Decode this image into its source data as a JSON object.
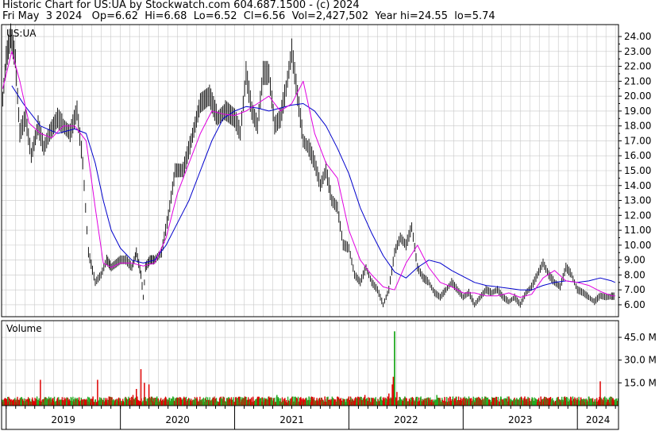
{
  "header": {
    "line1": "Historic Chart for US:UA by Stockwatch.com 604.687.1500 - (c) 2024",
    "line2": "Fri May  3 2024   Op=6.62  Hi=6.68  Lo=6.52  Cl=6.56  Vol=2,427,502  Year hi=24.55  lo=5.74"
  },
  "colors": {
    "price": "#000000",
    "ma_short": "#e000e0",
    "ma_long": "#0000cc",
    "vol_up": "#22aa22",
    "vol_down": "#dd0000",
    "grid": "#c8c8c8"
  },
  "chart_data": [
    {
      "type": "line",
      "symbol_label": "US:UA",
      "ylim": [
        5.2,
        24.8
      ],
      "y_ticks": [
        "24.00",
        "23.00",
        "22.00",
        "21.00",
        "20.00",
        "19.00",
        "18.00",
        "17.00",
        "16.00",
        "15.00",
        "14.00",
        "13.00",
        "12.00",
        "11.00",
        "10.00",
        "9.00",
        "8.00",
        "7.00",
        "6.00"
      ],
      "x_labels": [
        "2019",
        "2020",
        "2021",
        "2022",
        "2023",
        "2024"
      ],
      "x_range": [
        2018.96,
        2024.36
      ],
      "series": [
        {
          "style": "price",
          "x": [
            2018.97,
            2019.0,
            2019.04,
            2019.08,
            2019.12,
            2019.17,
            2019.22,
            2019.28,
            2019.33,
            2019.38,
            2019.45,
            2019.5,
            2019.56,
            2019.62,
            2019.67,
            2019.72,
            2019.78,
            2019.83,
            2019.88,
            2019.92,
            2020.0,
            2020.05,
            2020.1,
            2020.14,
            2020.18,
            2020.2,
            2020.22,
            2020.26,
            2020.3,
            2020.36,
            2020.42,
            2020.48,
            2020.55,
            2020.62,
            2020.7,
            2020.78,
            2020.85,
            2020.92,
            2021.0,
            2021.05,
            2021.1,
            2021.15,
            2021.2,
            2021.25,
            2021.3,
            2021.35,
            2021.4,
            2021.45,
            2021.5,
            2021.55,
            2021.6,
            2021.65,
            2021.7,
            2021.75,
            2021.8,
            2021.85,
            2021.9,
            2021.95,
            2022.0,
            2022.05,
            2022.1,
            2022.15,
            2022.2,
            2022.25,
            2022.3,
            2022.35,
            2022.4,
            2022.45,
            2022.5,
            2022.55,
            2022.6,
            2022.65,
            2022.7,
            2022.75,
            2022.8,
            2022.85,
            2022.9,
            2022.95,
            2023.0,
            2023.05,
            2023.1,
            2023.15,
            2023.2,
            2023.25,
            2023.3,
            2023.35,
            2023.4,
            2023.45,
            2023.5,
            2023.55,
            2023.6,
            2023.65,
            2023.7,
            2023.75,
            2023.8,
            2023.85,
            2023.9,
            2023.95,
            2024.0,
            2024.05,
            2024.1,
            2024.15,
            2024.2,
            2024.25,
            2024.3,
            2024.33
          ],
          "values": [
            19.8,
            22.5,
            24.0,
            22.5,
            17.5,
            18.5,
            16.0,
            18.0,
            16.5,
            17.5,
            18.5,
            18.0,
            17.5,
            19.0,
            15.5,
            9.5,
            7.5,
            8.0,
            9.0,
            8.5,
            9.0,
            9.0,
            8.5,
            9.5,
            8.0,
            6.5,
            8.5,
            9.0,
            9.0,
            9.5,
            12.0,
            15.0,
            15.0,
            17.0,
            19.5,
            20.0,
            18.5,
            19.0,
            18.5,
            17.5,
            21.5,
            19.0,
            18.0,
            21.5,
            21.5,
            18.0,
            18.5,
            20.5,
            23.0,
            20.0,
            17.0,
            16.5,
            15.5,
            14.0,
            15.0,
            13.0,
            12.5,
            10.0,
            9.8,
            8.0,
            7.5,
            8.5,
            7.5,
            7.0,
            6.0,
            7.0,
            9.5,
            10.5,
            10.0,
            11.2,
            8.5,
            7.8,
            7.5,
            6.8,
            6.5,
            7.0,
            7.5,
            7.0,
            6.5,
            6.8,
            6.0,
            6.5,
            7.0,
            6.8,
            7.0,
            6.5,
            6.2,
            6.5,
            6.0,
            6.8,
            7.2,
            8.0,
            8.8,
            8.0,
            7.5,
            7.2,
            8.5,
            8.0,
            7.0,
            6.8,
            6.5,
            6.2,
            6.6,
            6.5,
            6.56,
            6.56
          ]
        },
        {
          "style": "ma_short",
          "x": [
            2018.97,
            2019.05,
            2019.12,
            2019.2,
            2019.3,
            2019.4,
            2019.5,
            2019.6,
            2019.7,
            2019.78,
            2019.85,
            2019.92,
            2020.0,
            2020.1,
            2020.2,
            2020.3,
            2020.4,
            2020.5,
            2020.6,
            2020.7,
            2020.8,
            2020.9,
            2021.0,
            2021.1,
            2021.2,
            2021.3,
            2021.4,
            2021.5,
            2021.6,
            2021.7,
            2021.8,
            2021.9,
            2022.0,
            2022.1,
            2022.2,
            2022.3,
            2022.4,
            2022.5,
            2022.6,
            2022.7,
            2022.8,
            2022.9,
            2023.0,
            2023.1,
            2023.2,
            2023.3,
            2023.4,
            2023.5,
            2023.6,
            2023.7,
            2023.8,
            2023.9,
            2024.0,
            2024.1,
            2024.2,
            2024.3,
            2024.33
          ],
          "values": [
            20.5,
            23.0,
            21.0,
            18.2,
            17.5,
            17.2,
            18.0,
            18.0,
            17.0,
            12.5,
            8.8,
            8.5,
            8.8,
            8.8,
            8.6,
            8.8,
            10.5,
            13.5,
            15.5,
            17.5,
            19.0,
            18.8,
            18.7,
            19.0,
            19.5,
            20.0,
            19.0,
            19.5,
            21.0,
            17.5,
            15.5,
            14.5,
            11.0,
            9.0,
            8.0,
            7.2,
            7.0,
            8.8,
            10.0,
            8.5,
            7.5,
            7.2,
            6.8,
            6.8,
            6.6,
            6.6,
            6.8,
            6.5,
            6.7,
            7.8,
            8.3,
            7.6,
            7.5,
            7.3,
            6.9,
            6.6,
            6.6
          ]
        },
        {
          "style": "ma_long",
          "x": [
            2019.05,
            2019.15,
            2019.3,
            2019.45,
            2019.6,
            2019.7,
            2019.78,
            2019.85,
            2019.92,
            2020.0,
            2020.1,
            2020.2,
            2020.3,
            2020.4,
            2020.5,
            2020.6,
            2020.7,
            2020.8,
            2020.9,
            2021.0,
            2021.1,
            2021.2,
            2021.3,
            2021.4,
            2021.5,
            2021.6,
            2021.7,
            2021.8,
            2021.9,
            2022.0,
            2022.1,
            2022.2,
            2022.3,
            2022.4,
            2022.5,
            2022.6,
            2022.7,
            2022.8,
            2022.9,
            2023.0,
            2023.1,
            2023.2,
            2023.3,
            2023.4,
            2023.5,
            2023.6,
            2023.7,
            2023.8,
            2023.9,
            2024.0,
            2024.1,
            2024.2,
            2024.3,
            2024.33
          ],
          "values": [
            20.7,
            19.5,
            18.0,
            17.5,
            17.8,
            17.5,
            15.5,
            13.0,
            11.0,
            9.8,
            9.0,
            8.8,
            9.0,
            10.0,
            11.5,
            13.0,
            15.0,
            17.0,
            18.5,
            19.0,
            19.3,
            19.2,
            19.0,
            19.2,
            19.4,
            19.5,
            19.0,
            18.0,
            16.5,
            14.8,
            12.5,
            10.8,
            9.3,
            8.2,
            7.8,
            8.5,
            9.0,
            8.8,
            8.3,
            7.9,
            7.5,
            7.3,
            7.2,
            7.1,
            7.0,
            7.0,
            7.3,
            7.5,
            7.6,
            7.5,
            7.6,
            7.8,
            7.6,
            7.5
          ]
        }
      ]
    },
    {
      "type": "bar",
      "title": "Volume",
      "ylim": [
        0,
        56
      ],
      "y_ticks": [
        "45.0 M",
        "30.0 M",
        "15.0 M"
      ],
      "x": [
        2018.99,
        2019.06,
        2019.13,
        2019.2,
        2019.27,
        2019.3,
        2019.34,
        2019.41,
        2019.48,
        2019.55,
        2019.62,
        2019.69,
        2019.76,
        2019.8,
        2019.83,
        2019.9,
        2019.97,
        2020.04,
        2020.11,
        2020.14,
        2020.18,
        2020.21,
        2020.25,
        2020.32,
        2020.39,
        2020.46,
        2020.53,
        2020.6,
        2020.67,
        2020.74,
        2020.81,
        2020.88,
        2020.95,
        2021.02,
        2021.09,
        2021.16,
        2021.23,
        2021.3,
        2021.37,
        2021.44,
        2021.51,
        2021.58,
        2021.65,
        2021.72,
        2021.79,
        2021.86,
        2021.93,
        2022.0,
        2022.07,
        2022.14,
        2022.21,
        2022.28,
        2022.35,
        2022.38,
        2022.42,
        2022.49,
        2022.56,
        2022.63,
        2022.7,
        2022.77,
        2022.84,
        2022.91,
        2022.98,
        2023.05,
        2023.12,
        2023.19,
        2023.26,
        2023.33,
        2023.4,
        2023.47,
        2023.54,
        2023.61,
        2023.68,
        2023.75,
        2023.82,
        2023.89,
        2023.96,
        2024.03,
        2024.1,
        2024.17,
        2024.2,
        2024.24,
        2024.31
      ],
      "values": [
        5,
        4,
        5,
        4,
        6,
        17,
        5,
        5,
        4,
        4,
        5,
        4,
        6,
        17,
        5,
        6,
        4,
        5,
        7,
        11,
        24,
        15,
        14,
        6,
        5,
        6,
        5,
        4,
        5,
        4,
        5,
        5,
        4,
        5,
        6,
        5,
        5,
        6,
        7,
        5,
        6,
        5,
        6,
        5,
        6,
        5,
        5,
        6,
        5,
        7,
        5,
        6,
        8,
        14,
        9,
        6,
        5,
        6,
        5,
        7,
        5,
        6,
        5,
        6,
        5,
        6,
        5,
        6,
        6,
        5,
        6,
        5,
        6,
        5,
        5,
        6,
        6,
        5,
        6,
        5,
        16,
        6,
        5
      ],
      "colors": [
        "down",
        "down",
        "up",
        "down",
        "up",
        "down",
        "up",
        "down",
        "up",
        "down",
        "up",
        "down",
        "down",
        "down",
        "up",
        "down",
        "up",
        "up",
        "down",
        "down",
        "down",
        "down",
        "down",
        "up",
        "down",
        "up",
        "down",
        "up",
        "down",
        "up",
        "down",
        "up",
        "down",
        "up",
        "down",
        "down",
        "up",
        "down",
        "up",
        "down",
        "up",
        "down",
        "up",
        "down",
        "down",
        "up",
        "down",
        "down",
        "up",
        "down",
        "down",
        "up",
        "down",
        "down",
        "down",
        "up",
        "down",
        "up",
        "down",
        "up",
        "down",
        "up",
        "down",
        "up",
        "down",
        "up",
        "down",
        "up",
        "down",
        "up",
        "down",
        "up",
        "down",
        "down",
        "up",
        "down",
        "up",
        "down",
        "up",
        "down",
        "down",
        "up",
        "down"
      ]
    }
  ],
  "extra_vol_spikes": {
    "x": [
      2022.39,
      2022.4
    ],
    "values": [
      19,
      49
    ],
    "colors": [
      "down",
      "up"
    ]
  }
}
